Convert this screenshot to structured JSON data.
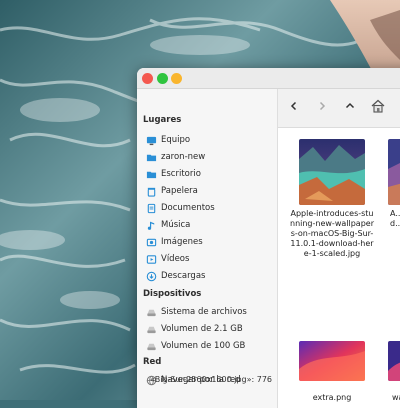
{
  "desktop": {
    "wallpaper": "ocean-waves-cliff"
  },
  "window": {
    "buttons": {
      "close_color": "#f4584f",
      "minimize_color": "#2fc43f",
      "maximize_color": "#f9b52d"
    }
  },
  "sidebar": {
    "sections": {
      "lugares": "Lugares",
      "dispositivos": "Dispositivos",
      "red": "Red"
    },
    "places": [
      {
        "label": "Equipo",
        "icon": "computer-icon"
      },
      {
        "label": "zaron-new",
        "icon": "home-folder-icon"
      },
      {
        "label": "Escritorio",
        "icon": "desktop-folder-icon"
      },
      {
        "label": "Papelera",
        "icon": "trash-icon"
      },
      {
        "label": "Documentos",
        "icon": "documents-icon"
      },
      {
        "label": "Música",
        "icon": "music-icon"
      },
      {
        "label": "Imágenes",
        "icon": "pictures-icon"
      },
      {
        "label": "Vídeos",
        "icon": "videos-icon"
      },
      {
        "label": "Descargas",
        "icon": "downloads-icon"
      }
    ],
    "devices": [
      {
        "label": "Sistema de archivos",
        "icon": "drive-icon"
      },
      {
        "label": "Volumen de 2.1 GB",
        "icon": "drive-icon"
      },
      {
        "label": "Volumen de 100 GB",
        "icon": "drive-icon"
      }
    ],
    "network": [
      {
        "label": "Navegar por la red",
        "icon": "network-icon"
      }
    ]
  },
  "files": [
    {
      "name": "Apple-introduces-stunning-new-wallpapers-on-macOS-Big-Sur-11.0.1-download-here-1-scaled.jpg"
    },
    {
      "name": "A... wal... d..."
    },
    {
      "name": "extra.png"
    },
    {
      "name": "wallp..."
    }
  ],
  "status": {
    "text": "«Big-Sur-2560x1600.jpg»: 776"
  },
  "accent": "#2a8fd6"
}
